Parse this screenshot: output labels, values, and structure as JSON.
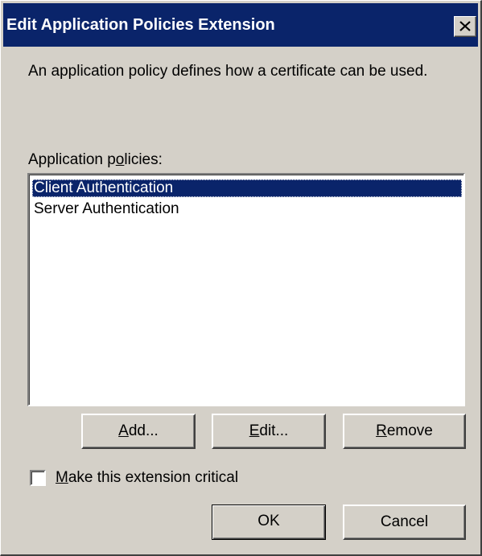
{
  "dialog": {
    "title": "Edit Application Policies Extension",
    "description": "An application policy defines how a certificate can be used.",
    "policies_label_pre": "Application p",
    "policies_label_mn": "o",
    "policies_label_post": "licies:",
    "policies": [
      {
        "label": "Client Authentication",
        "selected": true
      },
      {
        "label": "Server Authentication",
        "selected": false
      }
    ],
    "buttons": {
      "add": {
        "mn": "A",
        "rest": "dd..."
      },
      "edit": {
        "mn": "E",
        "rest": "dit..."
      },
      "remove": {
        "mn": "R",
        "rest": "emove"
      },
      "ok": "OK",
      "cancel": "Cancel"
    },
    "critical_checkbox": {
      "mn": "M",
      "rest": "ake this extension critical",
      "checked": false
    }
  },
  "icons": {
    "close": "close-icon"
  },
  "colors": {
    "titlebar": "#0a246a",
    "face": "#d4d0c8",
    "selection": "#0a246a"
  }
}
